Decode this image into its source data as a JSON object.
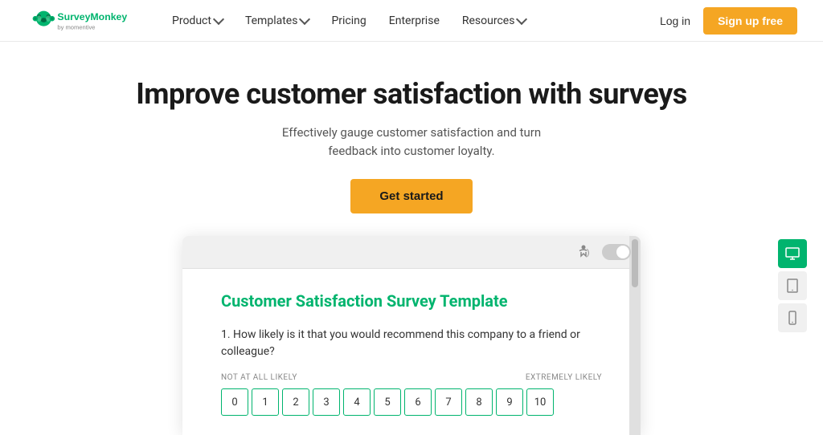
{
  "nav": {
    "logo_alt": "SurveyMonkey by Momentive",
    "items": [
      {
        "label": "Product",
        "has_dropdown": true
      },
      {
        "label": "Templates",
        "has_dropdown": true
      },
      {
        "label": "Pricing",
        "has_dropdown": false
      },
      {
        "label": "Enterprise",
        "has_dropdown": false
      },
      {
        "label": "Resources",
        "has_dropdown": true
      }
    ],
    "login_label": "Log in",
    "signup_label": "Sign up free"
  },
  "hero": {
    "heading": "Improve customer satisfaction with surveys",
    "subtext": "Effectively gauge customer satisfaction and turn feedback into customer loyalty.",
    "cta_label": "Get started"
  },
  "survey_preview": {
    "survey_title": "Customer Satisfaction Survey Template",
    "question_text": "1. How likely is it that you would recommend this company to a friend or colleague?",
    "rating_label_low": "NOT AT ALL LIKELY",
    "rating_label_high": "EXTREMELY LIKELY",
    "rating_numbers": [
      "0",
      "1",
      "2",
      "3",
      "4",
      "5",
      "6",
      "7",
      "8",
      "9",
      "10"
    ]
  },
  "colors": {
    "brand_green": "#00b46e",
    "cta_orange": "#f5a623"
  }
}
